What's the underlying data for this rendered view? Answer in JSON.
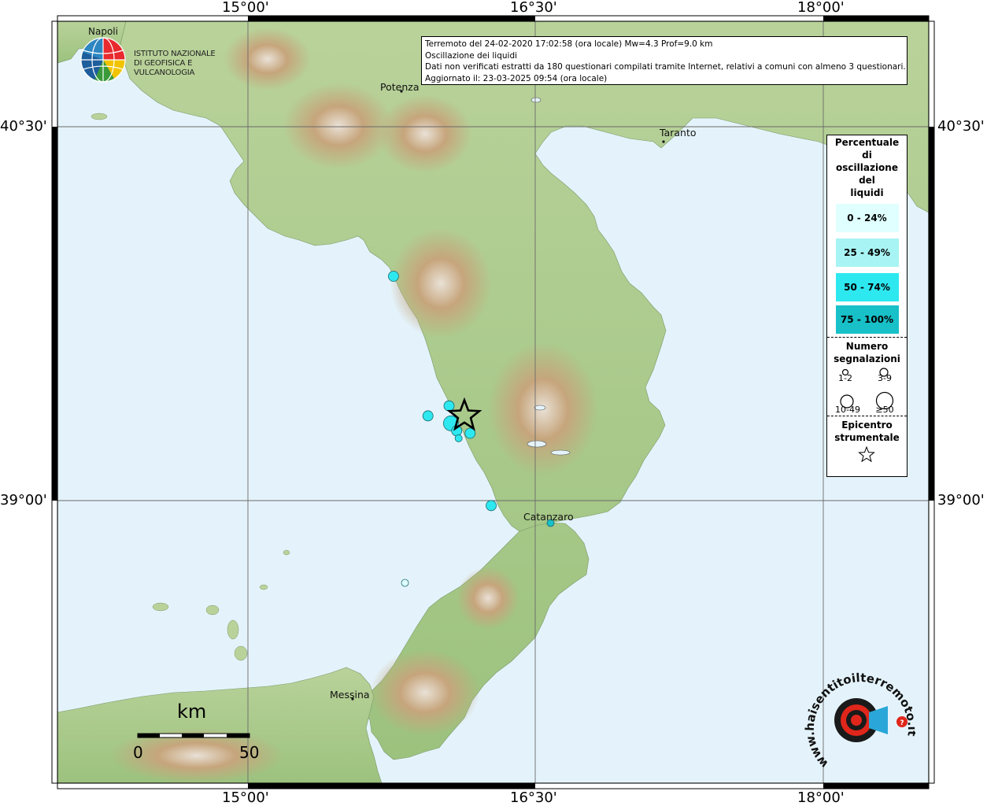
{
  "info": {
    "line1": "Terremoto del 24-02-2020 17:02:58 (ora locale) Mw=4.3 Prof=9.0 km",
    "line2": "Oscillazione dei liquidi",
    "line3": "Dati non verificati estratti da 180 questionari compilati tramite Internet, relativi a comuni con almeno 3 questionari.",
    "line4": "Aggiornato il: 23-03-2025 09:54 (ora locale)"
  },
  "logo": {
    "city": "Napoli",
    "line1": "ISTITUTO NAZIONALE",
    "line2": "DI GEOFISICA E VULCANOLOGIA"
  },
  "ticks": {
    "lon": [
      "15°00'",
      "16°30'",
      "18°00'"
    ],
    "lat": [
      "40°30'",
      "39°00'"
    ]
  },
  "cities": {
    "potenza": "Potenza",
    "taranto": "Taranto",
    "catanzaro": "Catanzaro",
    "messina": "Messina"
  },
  "scalebar": {
    "unit": "km",
    "min": "0",
    "max": "50"
  },
  "legend": {
    "title_lines": [
      "Percentuale",
      "di",
      "oscillazione",
      "del",
      "liquidi"
    ],
    "classes": [
      {
        "label": "0 - 24%",
        "color": "#e0ffff"
      },
      {
        "label": "25 - 49%",
        "color": "#a8f4f4"
      },
      {
        "label": "50 - 74%",
        "color": "#2ee8f0"
      },
      {
        "label": "75 - 100%",
        "color": "#18c0c8"
      }
    ],
    "count_title_lines": [
      "Numero",
      "segnalazioni"
    ],
    "sizes": [
      "1-2",
      "3-9",
      "10-49",
      "≥50"
    ],
    "epi_title_lines": [
      "Epicentro",
      "strumentale"
    ]
  },
  "hsit": {
    "text": "www.haisentitoilterremoto.it"
  },
  "points": [
    {
      "lon": 15.76,
      "lat": 39.9,
      "n": "3-9",
      "cls": "50 - 74%"
    },
    {
      "lon": 15.94,
      "lat": 39.34,
      "n": "3-9",
      "cls": "50 - 74%"
    },
    {
      "lon": 16.05,
      "lat": 39.38,
      "n": "3-9",
      "cls": "50 - 74%"
    },
    {
      "lon": 16.06,
      "lat": 39.31,
      "n": "10-49",
      "cls": "50 - 74%"
    },
    {
      "lon": 16.09,
      "lat": 39.28,
      "n": "3-9",
      "cls": "50 - 74%"
    },
    {
      "lon": 16.1,
      "lat": 39.25,
      "n": "1-2",
      "cls": "50 - 74%"
    },
    {
      "lon": 16.16,
      "lat": 39.27,
      "n": "3-9",
      "cls": "50 - 74%"
    },
    {
      "lon": 16.27,
      "lat": 38.98,
      "n": "3-9",
      "cls": "50 - 74%"
    },
    {
      "lon": 16.58,
      "lat": 38.91,
      "n": "1-2",
      "cls": "75 - 100%"
    },
    {
      "lon": 15.82,
      "lat": 38.67,
      "n": "1-2",
      "cls": "0 - 24%"
    }
  ],
  "epicenter": {
    "lon": 16.13,
    "lat": 39.34
  }
}
